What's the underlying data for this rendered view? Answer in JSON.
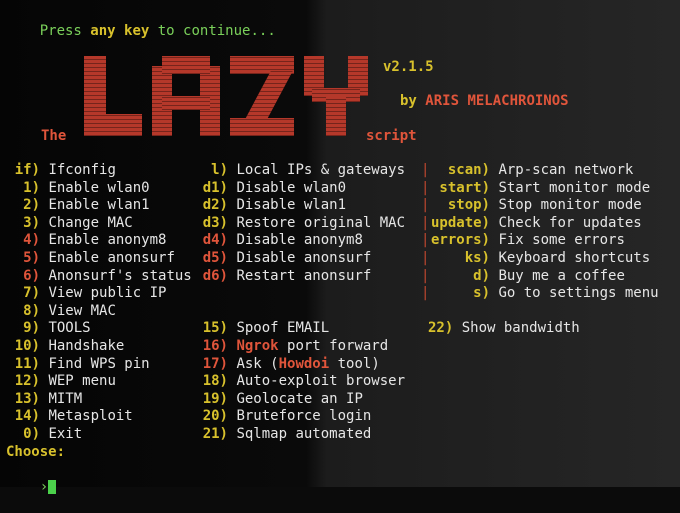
{
  "header": {
    "press_a": "Press ",
    "press_key": "any key",
    "press_b": " to continue..."
  },
  "logo": {
    "word": "LAZY",
    "version": "v2.1.5",
    "by_a": "by ",
    "author": "ARIS MELACHROINOS",
    "the": "The",
    "script": "script",
    "color": "#b5382a"
  },
  "menu_left": [
    {
      "key": "if)",
      "label": "Ifconfig",
      "key_color": "yellow"
    },
    {
      "key": "1)",
      "label": "Enable wlan0",
      "key_color": "yellow"
    },
    {
      "key": "2)",
      "label": "Enable wlan1",
      "key_color": "yellow"
    },
    {
      "key": "3)",
      "label": "Change MAC",
      "key_color": "yellow"
    },
    {
      "key": "4)",
      "label": "Enable anonym8",
      "key_color": "red"
    },
    {
      "key": "5)",
      "label": "Enable anonsurf",
      "key_color": "red"
    },
    {
      "key": "6)",
      "label": "Anonsurf's status",
      "key_color": "red"
    },
    {
      "key": "7)",
      "label": "View public IP",
      "key_color": "yellow"
    },
    {
      "key": "8)",
      "label": "View MAC",
      "key_color": "yellow"
    },
    {
      "key": "9)",
      "label": "TOOLS",
      "key_color": "yellow"
    },
    {
      "key": "10)",
      "label": "Handshake",
      "key_color": "yellow"
    },
    {
      "key": "11)",
      "label": "Find WPS pin",
      "key_color": "yellow"
    },
    {
      "key": "12)",
      "label": "WEP menu",
      "key_color": "yellow"
    },
    {
      "key": "13)",
      "label": "MITM",
      "key_color": "yellow"
    },
    {
      "key": "14)",
      "label": "Metasploit",
      "key_color": "yellow"
    },
    {
      "key": "0)",
      "label": "Exit",
      "key_color": "yellow"
    }
  ],
  "menu_mid": [
    {
      "key": "l)",
      "label": "Local IPs & gateways",
      "key_color": "yellow"
    },
    {
      "key": "d1)",
      "label": "Disable wlan0",
      "key_color": "yellow"
    },
    {
      "key": "d2)",
      "label": "Disable wlan1",
      "key_color": "yellow"
    },
    {
      "key": "d3)",
      "label": "Restore original MAC",
      "key_color": "yellow"
    },
    {
      "key": "d4)",
      "label": "Disable anonym8",
      "key_color": "red"
    },
    {
      "key": "d5)",
      "label": "Disable anonsurf",
      "key_color": "red"
    },
    {
      "key": "d6)",
      "label": "Restart anonsurf",
      "key_color": "red"
    }
  ],
  "menu_mid2": [
    {
      "key": "15)",
      "label": "Spoof EMAIL",
      "key_color": "yellow"
    },
    {
      "key": "16)",
      "label_a": "",
      "label_hl": "Ngrok",
      "label_b": " port forward",
      "key_color": "red"
    },
    {
      "key": "17)",
      "label_a": "Ask (",
      "label_hl": "Howdoi",
      "label_b": " tool)",
      "key_color": "red"
    },
    {
      "key": "18)",
      "label": "Auto-exploit browser",
      "key_color": "yellow"
    },
    {
      "key": "19)",
      "label": "Geolocate an IP",
      "key_color": "yellow"
    },
    {
      "key": "20)",
      "label": "Bruteforce login",
      "key_color": "yellow"
    },
    {
      "key": "21)",
      "label": "Sqlmap automated",
      "key_color": "yellow"
    }
  ],
  "menu_right": [
    {
      "key": "scan)",
      "label": "Arp-scan network"
    },
    {
      "key": "start)",
      "label": "Start monitor mode"
    },
    {
      "key": "stop)",
      "label": "Stop monitor mode"
    },
    {
      "key": "update)",
      "label": "Check for updates"
    },
    {
      "key": "errors)",
      "label": "Fix some errors"
    },
    {
      "key": "ks)",
      "label": "Keyboard shortcuts"
    },
    {
      "key": "d)",
      "label": "Buy me a coffee"
    },
    {
      "key": "s)",
      "label": "Go to settings menu"
    }
  ],
  "bandwidth": {
    "key": "22)",
    "label": "Show bandwidth"
  },
  "choose": "Choose:",
  "prompt": "›",
  "separator": "|",
  "colors": {
    "yellow": "#d8c12c",
    "red": "#e0553b",
    "green": "#4bd14b"
  }
}
